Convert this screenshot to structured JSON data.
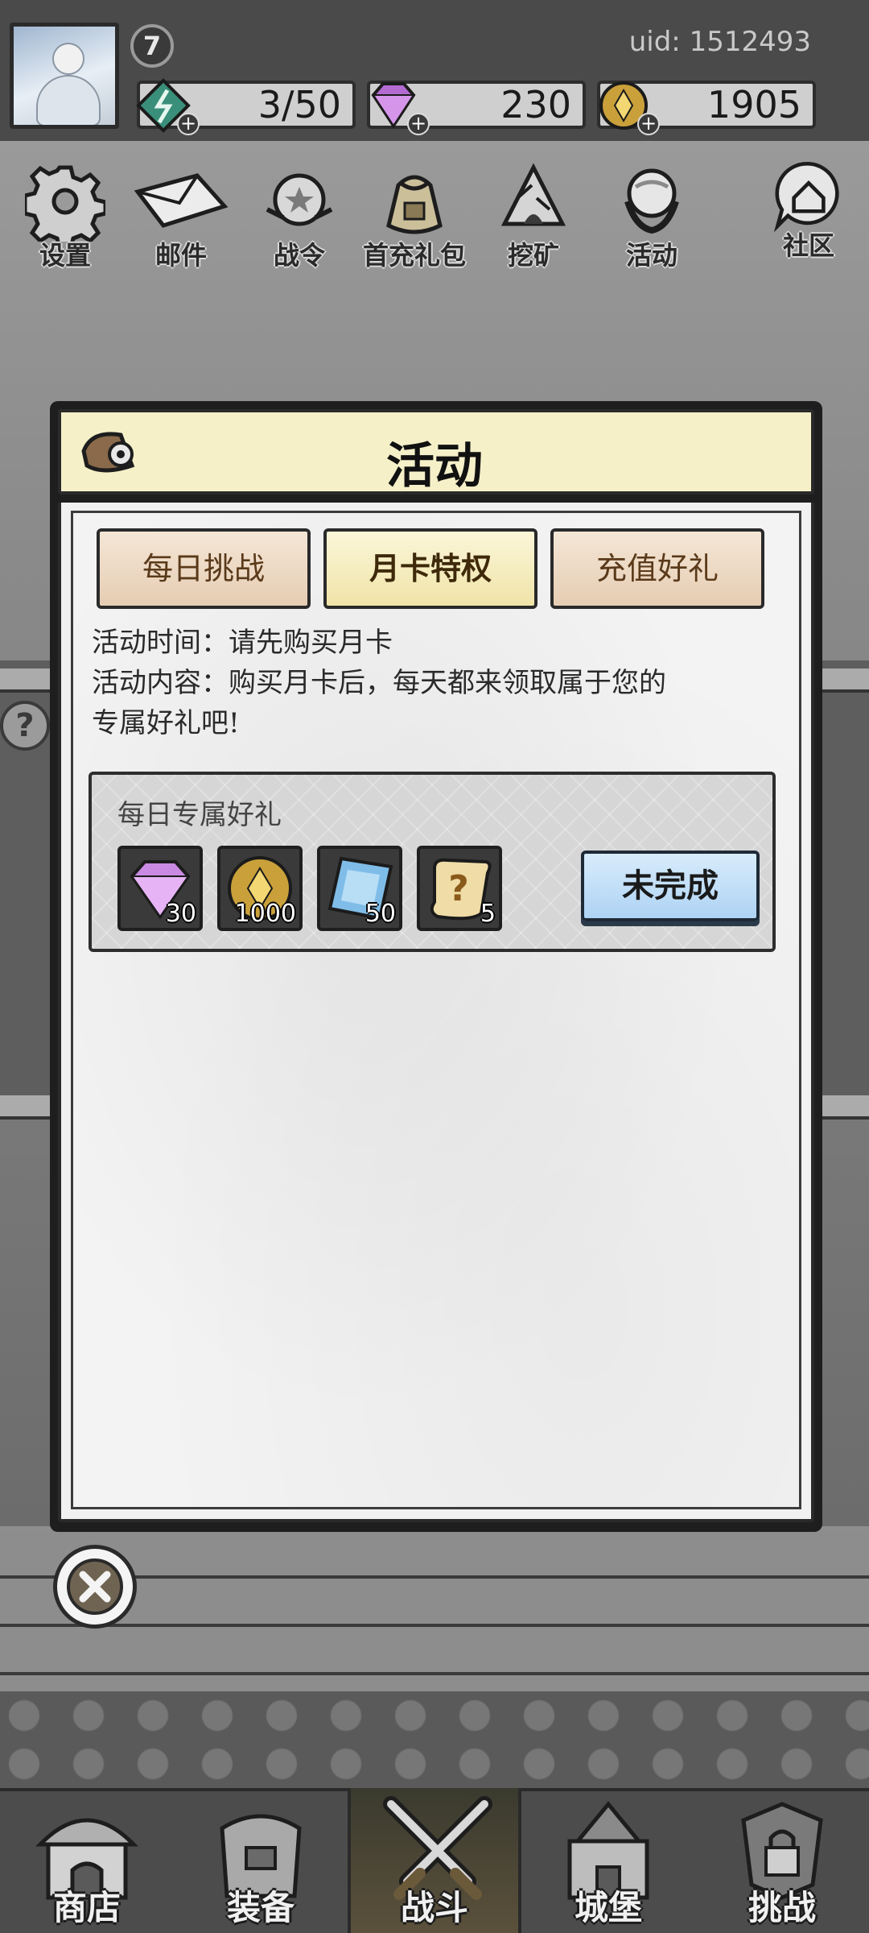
{
  "header": {
    "level": "7",
    "uid": "uid: 1512493",
    "resources": {
      "energy": "3/50",
      "gems": "230",
      "gold": "1905"
    }
  },
  "topnav": {
    "items": [
      {
        "label": "设置",
        "icon": "gear-icon"
      },
      {
        "label": "邮件",
        "icon": "mail-icon"
      },
      {
        "label": "战令",
        "icon": "battle-pass-icon"
      },
      {
        "label": "首充礼包",
        "icon": "gift-bag-icon"
      },
      {
        "label": "挖矿",
        "icon": "mining-icon"
      },
      {
        "label": "活动",
        "icon": "event-wreath-icon"
      },
      {
        "label": "社区",
        "icon": "community-home-icon"
      }
    ]
  },
  "modal": {
    "title": "活动",
    "tabs": [
      {
        "label": "每日挑战",
        "active": false
      },
      {
        "label": "月卡特权",
        "active": true
      },
      {
        "label": "充值好礼",
        "active": false
      }
    ],
    "activity_time": "活动时间：请先购买月卡",
    "activity_content_line1": "活动内容：购买月卡后，每天都来领取属于您的",
    "activity_content_line2": "专属好礼吧!",
    "reward_panel": {
      "title": "每日专属好礼",
      "rewards": [
        {
          "icon": "gem-icon",
          "count": "30"
        },
        {
          "icon": "gold-coin-icon",
          "count": "1000"
        },
        {
          "icon": "crystal-icon",
          "count": "50"
        },
        {
          "icon": "mystery-scroll-icon",
          "count": "5"
        }
      ],
      "status_button": "未完成"
    }
  },
  "bottomnav": {
    "items": [
      {
        "label": "商店",
        "icon": "shop-icon",
        "active": false
      },
      {
        "label": "装备",
        "icon": "equipment-bag-icon",
        "active": false
      },
      {
        "label": "战斗",
        "icon": "crossed-swords-icon",
        "active": true
      },
      {
        "label": "城堡",
        "icon": "castle-icon",
        "active": false
      },
      {
        "label": "挑战",
        "icon": "challenge-lock-icon",
        "active": false
      }
    ]
  },
  "colors": {
    "modal_header_bg": "#f6f0c9",
    "tab_active_bg": "#f0e4a8",
    "tab_inactive_bg": "#e6cdb3",
    "status_button_bg": "#aed3f4"
  }
}
